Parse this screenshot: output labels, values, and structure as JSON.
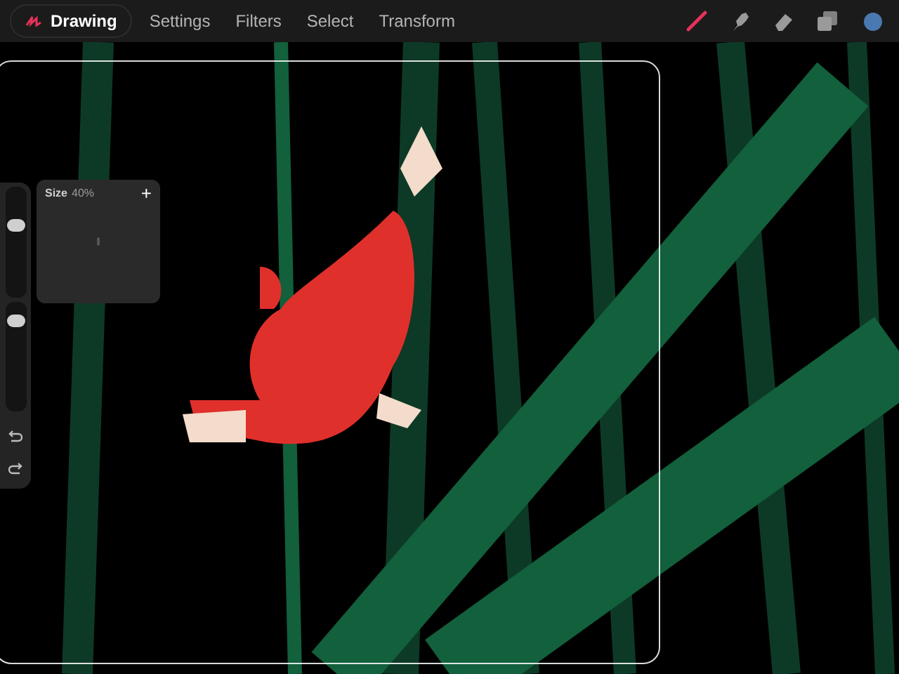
{
  "document": {
    "title": "Drawing"
  },
  "menu": [
    {
      "label": "Settings"
    },
    {
      "label": "Filters"
    },
    {
      "label": "Select"
    },
    {
      "label": "Transform"
    }
  ],
  "tools": [
    {
      "kind": "brush",
      "selected": true
    },
    {
      "kind": "smudge",
      "selected": false
    },
    {
      "kind": "eraser",
      "selected": false
    },
    {
      "kind": "layers",
      "selected": false
    }
  ],
  "current_color": {
    "color": "#4a78b0"
  },
  "sidebar": {
    "size_slider": {
      "level": 0.66
    },
    "opacity_slider": {
      "level": 0.92
    }
  },
  "size_popup": {
    "label": "Size",
    "value": "40%",
    "add": "+"
  }
}
